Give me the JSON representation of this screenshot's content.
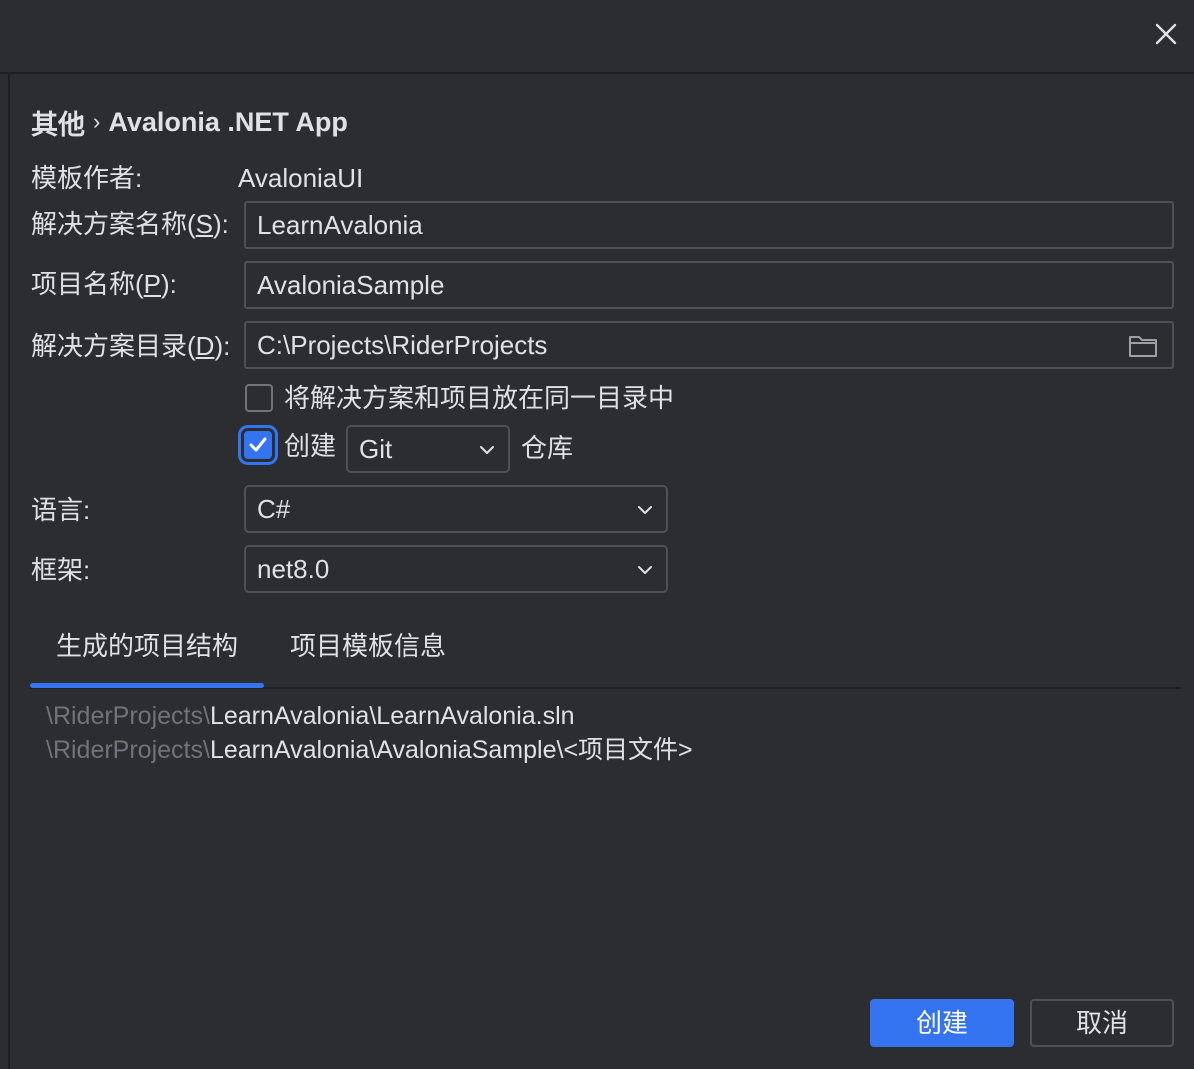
{
  "window": {
    "close_icon": "close-icon"
  },
  "breadcrumb": {
    "category": "其他",
    "separator": "›",
    "template": "Avalonia .NET App"
  },
  "form": {
    "author_label": "模板作者:",
    "author_value": "AvaloniaUI",
    "solution_name_label_prefix": "解决方案名称(",
    "solution_name_mnemonic": "S",
    "solution_name_label_suffix": "):",
    "solution_name_value": "LearnAvalonia",
    "project_name_label_prefix": "项目名称(",
    "project_name_mnemonic": "P",
    "project_name_label_suffix": "):",
    "project_name_value": "AvaloniaSample",
    "solution_dir_label_prefix": "解决方案目录(",
    "solution_dir_mnemonic": "D",
    "solution_dir_label_suffix": "):",
    "solution_dir_value": "C:\\Projects\\RiderProjects",
    "same_dir_checkbox_label": "将解决方案和项目放在同一目录中",
    "same_dir_checked": false,
    "create_repo_prefix": "创建",
    "create_repo_checked": true,
    "vcs_selected": "Git",
    "create_repo_suffix": "仓库",
    "language_label": "语言:",
    "language_selected": "C#",
    "framework_label": "框架:",
    "framework_selected": "net8.0"
  },
  "tabs": [
    {
      "label": "生成的项目结构",
      "active": true
    },
    {
      "label": "项目模板信息",
      "active": false
    }
  ],
  "structure": [
    {
      "dim": "\\RiderProjects\\",
      "bright": "LearnAvalonia\\LearnAvalonia.sln"
    },
    {
      "dim": "\\RiderProjects\\",
      "bright": "LearnAvalonia\\AvaloniaSample\\<项目文件>"
    }
  ],
  "buttons": {
    "create": "创建",
    "cancel": "取消"
  },
  "colors": {
    "background": "#2b2d30",
    "accent": "#3574f0",
    "text": "#dfe1e5",
    "dim_text": "#6f737a",
    "border": "#4e5157"
  }
}
